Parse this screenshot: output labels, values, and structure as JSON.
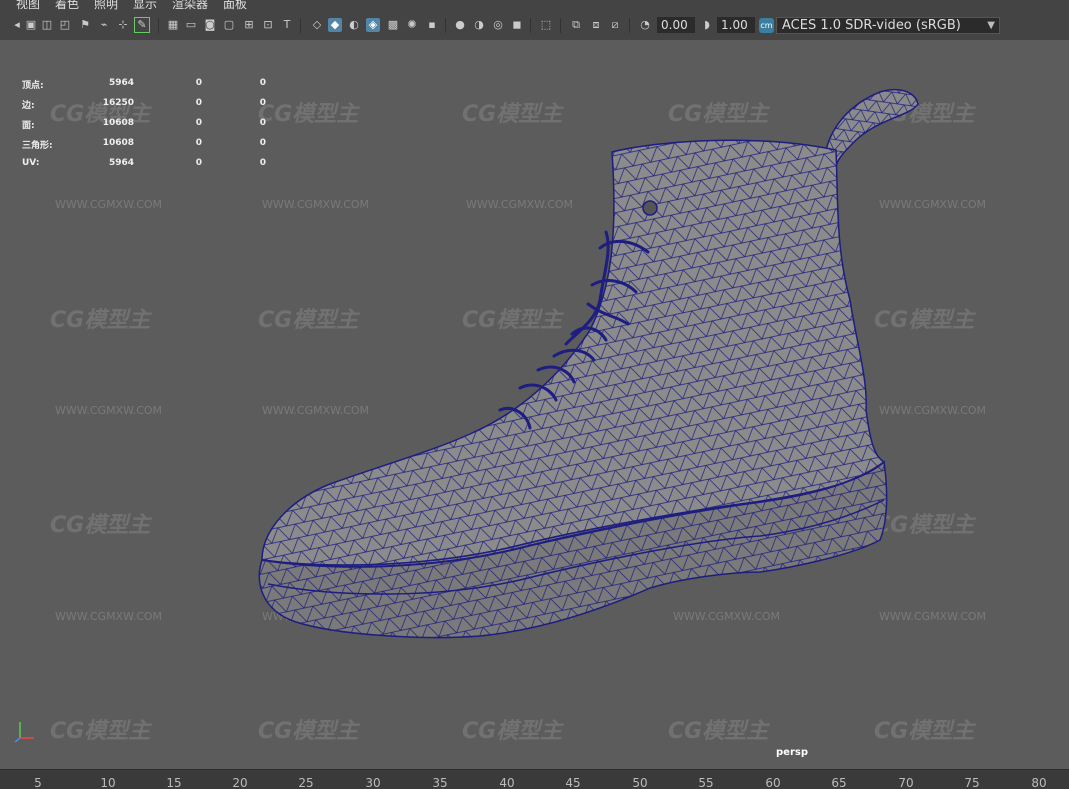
{
  "menu": {
    "items": [
      "视图",
      "着色",
      "照明",
      "显示",
      "渲染器",
      "面板"
    ]
  },
  "toolbar": {
    "value_a": "0.00",
    "value_b": "1.00",
    "color_management": {
      "label": "ACES 1.0 SDR-video (sRGB)",
      "icon": "colorspace-icon"
    }
  },
  "hud": {
    "rows": [
      {
        "label": "顶点:",
        "v1": "5964",
        "v2": "0",
        "v3": "0"
      },
      {
        "label": "边:",
        "v1": "16250",
        "v2": "0",
        "v3": "0"
      },
      {
        "label": "面:",
        "v1": "10608",
        "v2": "0",
        "v3": "0"
      },
      {
        "label": "三角形:",
        "v1": "10608",
        "v2": "0",
        "v3": "0"
      },
      {
        "label": "UV:",
        "v1": "5964",
        "v2": "0",
        "v3": "0"
      }
    ]
  },
  "camera": {
    "label": "persp"
  },
  "timeline": {
    "ticks": [
      "5",
      "10",
      "15",
      "20",
      "25",
      "30",
      "35",
      "40",
      "45",
      "50",
      "55",
      "60",
      "65",
      "70",
      "75",
      "80"
    ]
  },
  "watermark": {
    "logo": "CG模型主",
    "url": "WWW.CGMXW.COM"
  },
  "colors": {
    "wire": "#1e1d80",
    "mesh": "#8b8b8b",
    "viewport": "#5c5c5c",
    "accent": "#5285a6"
  }
}
